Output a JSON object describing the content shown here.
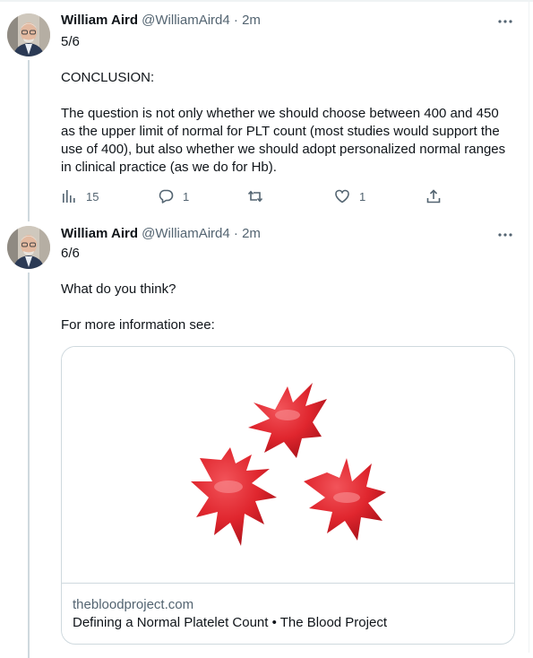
{
  "tweets": [
    {
      "author_name": "William Aird",
      "handle": "@WilliamAird4",
      "separator": "·",
      "time": "2m",
      "text": "5/6\n\nCONCLUSION:\n\nThe question is not only whether we should choose between 400 and 450 as the upper limit of normal for PLT count (most studies would support the use of 400), but also whether we should adopt personalized normal ranges in clinical practice (as we do for Hb).",
      "analytics_count": "15",
      "reply_count": "1",
      "retweet_count": "",
      "like_count": "1"
    },
    {
      "author_name": "William Aird",
      "handle": "@WilliamAird4",
      "separator": "·",
      "time": "2m",
      "text": "6/6\n\nWhat do you think?\n\nFor more information see:",
      "card": {
        "domain": "thebloodproject.com",
        "title": "Defining a Normal Platelet Count • The Blood Project"
      }
    }
  ],
  "icons": {
    "analytics": "bar-chart-icon",
    "reply": "speech-bubble-icon",
    "retweet": "retweet-arrows-icon",
    "like": "heart-icon",
    "share": "share-upload-icon",
    "more": "more-dots-icon"
  },
  "colors": {
    "text_primary": "#0f1419",
    "text_secondary": "#536471",
    "border": "#cfd9de",
    "platelet_red": "#e0262e"
  }
}
